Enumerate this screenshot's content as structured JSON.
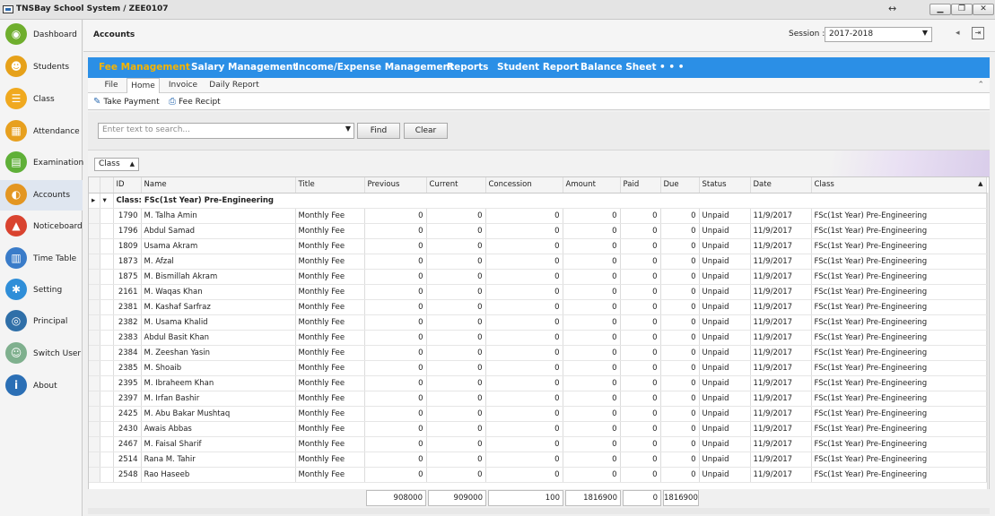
{
  "window": {
    "title": "TNSBay School System / ZEE0107",
    "resize_icon": "↔",
    "minimize": "▁",
    "restore": "❐",
    "close": "✕"
  },
  "sidebar": {
    "items": [
      {
        "label": "Dashboard",
        "icon": "dashboard-icon",
        "color": "#6fae2d",
        "glyph": "◉"
      },
      {
        "label": "Students",
        "icon": "students-icon",
        "color": "#e6a11a",
        "glyph": "☻"
      },
      {
        "label": "Class",
        "icon": "class-icon",
        "color": "#f0a91f",
        "glyph": "☰"
      },
      {
        "label": "Attendance",
        "icon": "attendance-icon",
        "color": "#e7a01f",
        "glyph": "▦"
      },
      {
        "label": "Examination",
        "icon": "examination-icon",
        "color": "#5fb038",
        "glyph": "▤"
      },
      {
        "label": "Accounts",
        "icon": "accounts-icon",
        "color": "#e39622",
        "glyph": "◐"
      },
      {
        "label": "Noticeboard",
        "icon": "noticeboard-icon",
        "color": "#d9432f",
        "glyph": "▲"
      },
      {
        "label": "Time Table",
        "icon": "timetable-icon",
        "color": "#3a7cc9",
        "glyph": "▥"
      },
      {
        "label": "Setting",
        "icon": "setting-icon",
        "color": "#2f8ed8",
        "glyph": "✱"
      },
      {
        "label": "Principal",
        "icon": "principal-icon",
        "color": "#2f6fa8",
        "glyph": "◎"
      },
      {
        "label": "Switch User",
        "icon": "switch-user-icon",
        "color": "#7fb08e",
        "glyph": "☺"
      },
      {
        "label": "About",
        "icon": "about-icon",
        "color": "#2b6fb5",
        "glyph": "i"
      }
    ]
  },
  "header": {
    "title": "Accounts",
    "session_label": "Session :",
    "session_value": "2017-2018",
    "dropdown_arrow": "▼",
    "back_icon": "◂",
    "exit_icon": "⇥"
  },
  "menu": [
    "Fee Management",
    "Salary Management",
    "Income/Expense Management",
    "Reports",
    "Student Report",
    "Balance Sheet",
    "• • •"
  ],
  "tabs": [
    "File",
    "Home",
    "Invoice",
    "Daily Report"
  ],
  "collapse_icon": "⌃",
  "tools": {
    "take_payment": "Take Payment",
    "fee_recipt": "Fee Recipt",
    "pencil_icon": "✎",
    "receipt_icon": "⎙"
  },
  "search": {
    "placeholder": "Enter text to search...",
    "arrow": "▼",
    "find": "Find",
    "clear": "Clear"
  },
  "group_chip": {
    "label": "Class",
    "arrow": "▲"
  },
  "grid": {
    "columns": [
      "ID",
      "Name",
      "Title",
      "Previous",
      "Current",
      "Concession",
      "Amount",
      "Paid",
      "Due",
      "Status",
      "Date",
      "Class"
    ],
    "sort_arrow": "▲",
    "row_marker": "▸",
    "expand_marker": "▾",
    "group_label": "Class: FSc(1st Year) Pre-Engineering",
    "rows": [
      [
        "1790",
        "M. Talha Amin",
        "Monthly Fee",
        "0",
        "0",
        "0",
        "0",
        "0",
        "0",
        "Unpaid",
        "11/9/2017",
        "FSc(1st Year) Pre-Engineering"
      ],
      [
        "1796",
        "Abdul Samad",
        "Monthly Fee",
        "0",
        "0",
        "0",
        "0",
        "0",
        "0",
        "Unpaid",
        "11/9/2017",
        "FSc(1st Year) Pre-Engineering"
      ],
      [
        "1809",
        "Usama Akram",
        "Monthly Fee",
        "0",
        "0",
        "0",
        "0",
        "0",
        "0",
        "Unpaid",
        "11/9/2017",
        "FSc(1st Year) Pre-Engineering"
      ],
      [
        "1873",
        "M. Afzal",
        "Monthly Fee",
        "0",
        "0",
        "0",
        "0",
        "0",
        "0",
        "Unpaid",
        "11/9/2017",
        "FSc(1st Year) Pre-Engineering"
      ],
      [
        "1875",
        "M. Bismillah Akram",
        "Monthly Fee",
        "0",
        "0",
        "0",
        "0",
        "0",
        "0",
        "Unpaid",
        "11/9/2017",
        "FSc(1st Year) Pre-Engineering"
      ],
      [
        "2161",
        "M. Waqas Khan",
        "Monthly Fee",
        "0",
        "0",
        "0",
        "0",
        "0",
        "0",
        "Unpaid",
        "11/9/2017",
        "FSc(1st Year) Pre-Engineering"
      ],
      [
        "2381",
        "M. Kashaf Sarfraz",
        "Monthly Fee",
        "0",
        "0",
        "0",
        "0",
        "0",
        "0",
        "Unpaid",
        "11/9/2017",
        "FSc(1st Year) Pre-Engineering"
      ],
      [
        "2382",
        "M. Usama Khalid",
        "Monthly Fee",
        "0",
        "0",
        "0",
        "0",
        "0",
        "0",
        "Unpaid",
        "11/9/2017",
        "FSc(1st Year) Pre-Engineering"
      ],
      [
        "2383",
        "Abdul Basit Khan",
        "Monthly Fee",
        "0",
        "0",
        "0",
        "0",
        "0",
        "0",
        "Unpaid",
        "11/9/2017",
        "FSc(1st Year) Pre-Engineering"
      ],
      [
        "2384",
        "M. Zeeshan Yasin",
        "Monthly Fee",
        "0",
        "0",
        "0",
        "0",
        "0",
        "0",
        "Unpaid",
        "11/9/2017",
        "FSc(1st Year) Pre-Engineering"
      ],
      [
        "2385",
        "M. Shoaib",
        "Monthly Fee",
        "0",
        "0",
        "0",
        "0",
        "0",
        "0",
        "Unpaid",
        "11/9/2017",
        "FSc(1st Year) Pre-Engineering"
      ],
      [
        "2395",
        "M. Ibraheem Khan",
        "Monthly Fee",
        "0",
        "0",
        "0",
        "0",
        "0",
        "0",
        "Unpaid",
        "11/9/2017",
        "FSc(1st Year) Pre-Engineering"
      ],
      [
        "2397",
        "M. Irfan Bashir",
        "Monthly Fee",
        "0",
        "0",
        "0",
        "0",
        "0",
        "0",
        "Unpaid",
        "11/9/2017",
        "FSc(1st Year) Pre-Engineering"
      ],
      [
        "2425",
        "M. Abu Bakar Mushtaq",
        "Monthly Fee",
        "0",
        "0",
        "0",
        "0",
        "0",
        "0",
        "Unpaid",
        "11/9/2017",
        "FSc(1st Year) Pre-Engineering"
      ],
      [
        "2430",
        "Awais Abbas",
        "Monthly Fee",
        "0",
        "0",
        "0",
        "0",
        "0",
        "0",
        "Unpaid",
        "11/9/2017",
        "FSc(1st Year) Pre-Engineering"
      ],
      [
        "2467",
        "M. Faisal Sharif",
        "Monthly Fee",
        "0",
        "0",
        "0",
        "0",
        "0",
        "0",
        "Unpaid",
        "11/9/2017",
        "FSc(1st Year) Pre-Engineering"
      ],
      [
        "2514",
        "Rana M. Tahir",
        "Monthly Fee",
        "0",
        "0",
        "0",
        "0",
        "0",
        "0",
        "Unpaid",
        "11/9/2017",
        "FSc(1st Year) Pre-Engineering"
      ],
      [
        "2548",
        "Rao Haseeb",
        "Monthly Fee",
        "0",
        "0",
        "0",
        "0",
        "0",
        "0",
        "Unpaid",
        "11/9/2017",
        "FSc(1st Year) Pre-Engineering"
      ]
    ],
    "totals": {
      "previous": "908000",
      "current": "909000",
      "concession": "100",
      "amount": "1816900",
      "paid": "0",
      "due": "1816900"
    }
  },
  "colors": {
    "accent": "#2b8fe6",
    "active_menu": "#f6b400"
  }
}
